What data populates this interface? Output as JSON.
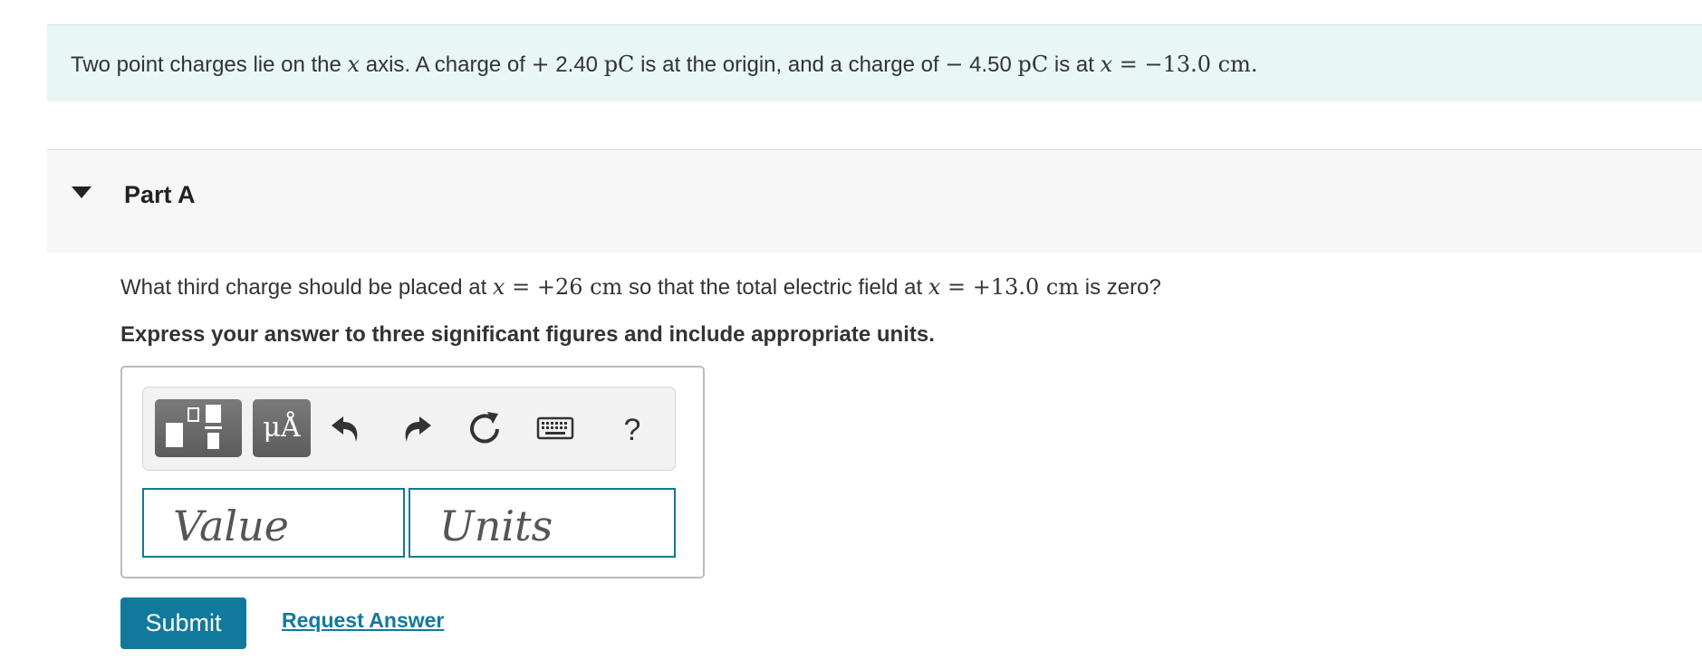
{
  "intro": {
    "t1": "Two point charges lie on the ",
    "m1": "x",
    "t2": " axis. A charge of ",
    "m2": "+",
    "t3": " 2.40 ",
    "m3": "pC",
    "t4": " is at the origin, and a charge of ",
    "m4": "−",
    "t5": " 4.50 ",
    "m5": "pC",
    "t6": " is at ",
    "m6": "x",
    "m7": " = −13.0 cm."
  },
  "part": {
    "title": "Part A"
  },
  "question": {
    "t1": "What third charge should be placed at ",
    "m1": "x",
    "m2": " = +26 cm",
    "t2": " so that the total electric field at ",
    "m3": "x",
    "m4": " = +13.0 cm",
    "t3": " is zero?",
    "instruction": "Express your answer to three significant figures and include appropriate units."
  },
  "toolbar": {
    "template_icon": "templates-icon",
    "symbol_label": "μÅ",
    "undo_icon": "undo-icon",
    "redo_icon": "redo-icon",
    "reset_icon": "reset-icon",
    "keyboard_icon": "keyboard-icon",
    "help_label": "?"
  },
  "inputs": {
    "value_placeholder": "Value",
    "units_placeholder": "Units"
  },
  "actions": {
    "submit_label": "Submit",
    "request_label": "Request Answer"
  },
  "colors": {
    "accent": "#117a9c",
    "intro_bg": "#e8f6f6",
    "part_bg": "#f7f7f7"
  }
}
